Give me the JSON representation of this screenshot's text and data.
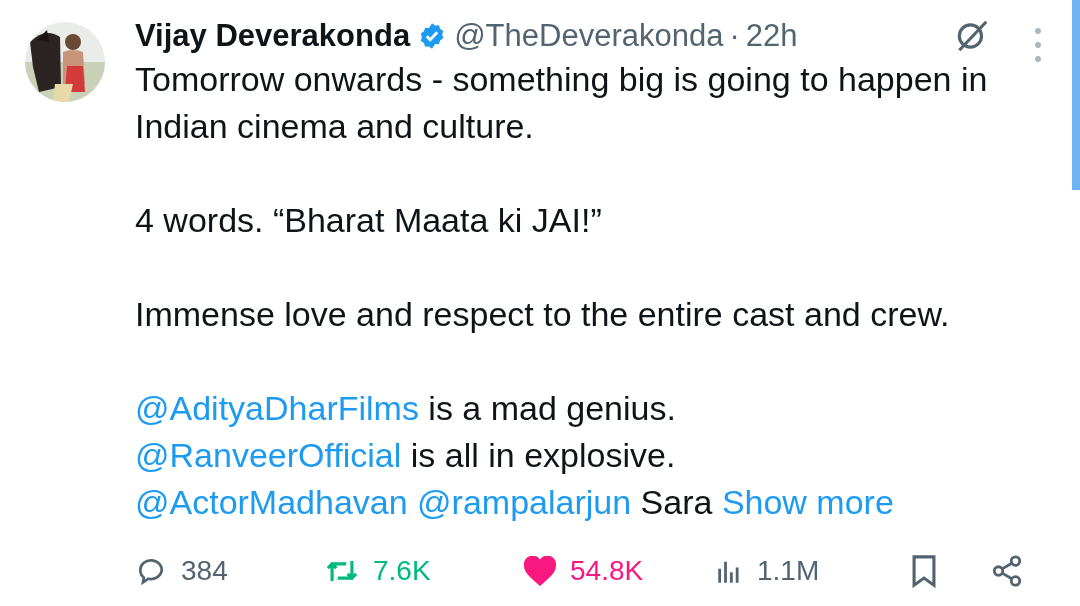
{
  "author": {
    "name": "Vijay Deverakonda",
    "verified": true,
    "handle": "@TheDeverakonda",
    "separator": "·",
    "time": "22h"
  },
  "paragraphs": [
    [
      {
        "kind": "text",
        "text": "Tomorrow onwards - something big is going to happen in Indian cinema and culture."
      }
    ],
    [
      {
        "kind": "text",
        "text": "4 words. “Bharat Maata ki JAI!”"
      }
    ],
    [
      {
        "kind": "text",
        "text": "Immense love and respect to the entire cast and crew."
      }
    ],
    [
      {
        "kind": "mention",
        "text": "@AdityaDharFilms"
      },
      {
        "kind": "text",
        "text": " is a mad genius."
      },
      {
        "kind": "break"
      },
      {
        "kind": "mention",
        "text": "@RanveerOfficial"
      },
      {
        "kind": "text",
        "text": " is all in explosive."
      },
      {
        "kind": "break"
      },
      {
        "kind": "mention",
        "text": "@ActorMadhavan"
      },
      {
        "kind": "space"
      },
      {
        "kind": "mention",
        "text": "@rampalarjun"
      },
      {
        "kind": "text",
        "text": " Sara "
      },
      {
        "kind": "link",
        "text": "Show more"
      }
    ]
  ],
  "actions": {
    "replies": "384",
    "reposts": "7.6K",
    "reposted": true,
    "likes": "54.8K",
    "liked": true,
    "views": "1.1M",
    "bookmarked": false
  }
}
